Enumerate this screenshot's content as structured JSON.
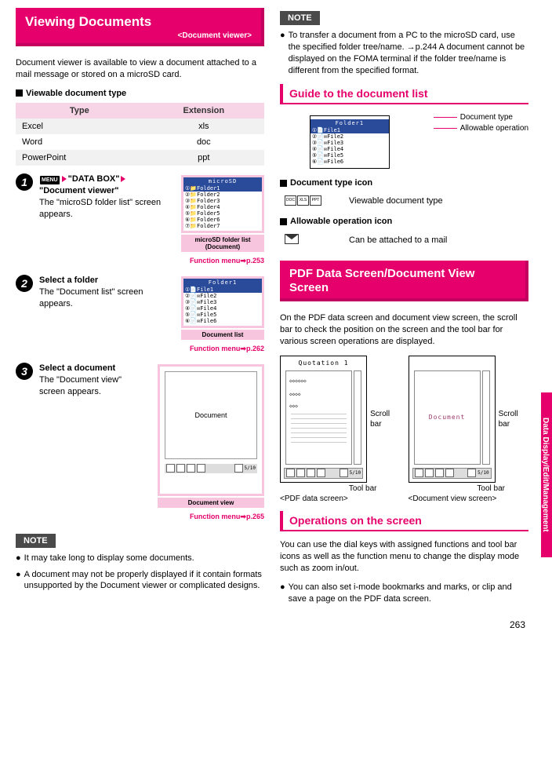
{
  "left": {
    "header": {
      "title": "Viewing Documents",
      "sub": "<Document viewer>"
    },
    "intro": "Document viewer is available to view a document attached to a mail message or stored on a microSD card.",
    "viewable_hdr": "Viewable document type",
    "table": {
      "headers": [
        "Type",
        "Extension"
      ],
      "rows": [
        [
          "Excel",
          "xls"
        ],
        [
          "Word",
          "doc"
        ],
        [
          "PowerPoint",
          "ppt"
        ]
      ]
    },
    "step1": {
      "menu_label": "MENU",
      "path1": "\"DATA BOX\"",
      "path2": "\"Document viewer\"",
      "desc": "The \"microSD folder list\" screen appears.",
      "phone_title": "microSD",
      "phone_rows": [
        "①📁Folder1",
        "②📁Folder2",
        "③📁Folder3",
        "④📁Folder4",
        "⑤📁Folder5",
        "⑥📁Folder6",
        "⑦📁Folder7"
      ],
      "caption": "microSD folder list\n(Document)",
      "func": "Function menu➡p.253"
    },
    "step2": {
      "title": "Select a folder",
      "desc": "The \"Document list\" screen appears.",
      "phone_title": "Folder1",
      "phone_rows": [
        "①📄File1",
        "②📄✉File2",
        "③📄✉File3",
        "④📄✉File4",
        "⑤📄✉File5",
        "⑥📄✉File6"
      ],
      "caption": "Document list",
      "func": "Function menu➡p.262"
    },
    "step3": {
      "title": "Select a document",
      "desc": "The \"Document view\" screen appears.",
      "doc_label": "Document",
      "caption": "Document view",
      "func": "Function menu➡p.265"
    },
    "note_label": "NOTE",
    "notes": [
      "It may take long to display some documents.",
      "A document may not be properly displayed if it contain formats unsupported by the Document viewer or complicated designs."
    ]
  },
  "right": {
    "note_label": "NOTE",
    "notes": [
      "To transfer a document from a PC to the microSD card, use the specified folder tree/name. →p.244 A document cannot be displayed on the FOMA terminal if the folder tree/name is different from the specified format."
    ],
    "guide_hdr": "Guide to the document list",
    "callout": {
      "title": "Folder1",
      "rows": [
        "①📄File1",
        "②📄✉File2",
        "③📄✉File3",
        "④📄✉File4",
        "⑤📄✉File5",
        "⑥📄✉File6"
      ],
      "l1": "Document type",
      "l2": "Allowable operation"
    },
    "dt_icon_hdr": "Document type icon",
    "dt_icon_desc": "Viewable document type",
    "ao_icon_hdr": "Allowable operation icon",
    "ao_icon_desc": "Can be attached to a mail",
    "pdf_hdr": "PDF Data Screen/Document View Screen",
    "pdf_intro": "On the PDF data screen and document view screen, the scroll bar to check the position on the screen and the tool bar for various screen operations are displayed.",
    "screens": {
      "left_title": "Quotation 1",
      "right_title": "Document",
      "scroll": "Scroll bar",
      "toolbar": "Tool bar",
      "left_cap": "<PDF data screen>",
      "right_cap": "<Document view screen>",
      "page_counter": "5/10"
    },
    "ops_hdr": "Operations on the screen",
    "ops_text": "You can use the dial keys with assigned functions and tool bar icons as well as the function menu to change the display mode such as zoom in/out.",
    "ops_bullet": "You can also set i-mode bookmarks and marks, or clip and save a page on the PDF data screen."
  },
  "side_tab": "Data Display/Edit/Management",
  "page_num": "263"
}
